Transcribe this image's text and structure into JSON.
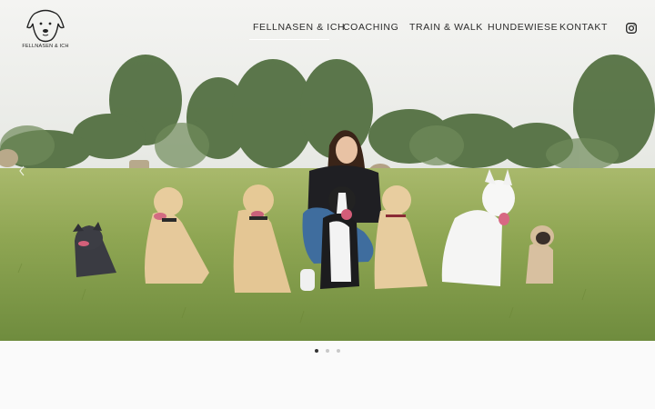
{
  "logo": {
    "text": "FELLNASEN & ICH",
    "icon": "dog-head-logo-icon"
  },
  "nav": {
    "items": [
      {
        "label": "FELLNASEN & ICH",
        "active": true
      },
      {
        "label": "COACHING",
        "active": false
      },
      {
        "label": "TRAIN & WALK",
        "active": false
      },
      {
        "label": "HUNDEWIESE",
        "active": false
      },
      {
        "label": "KONTAKT",
        "active": false
      }
    ],
    "social_icon": "instagram-icon"
  },
  "slider": {
    "image_alt": "Woman sitting in a meadow with seven dogs",
    "prev_icon": "chevron-left-icon",
    "slide_count": 3,
    "active_slide": 1
  },
  "colors": {
    "nav_text": "#2b2b2b",
    "dot_active": "#333333",
    "dot_inactive": "#c8c8c8",
    "page_bg": "#fafafa"
  }
}
